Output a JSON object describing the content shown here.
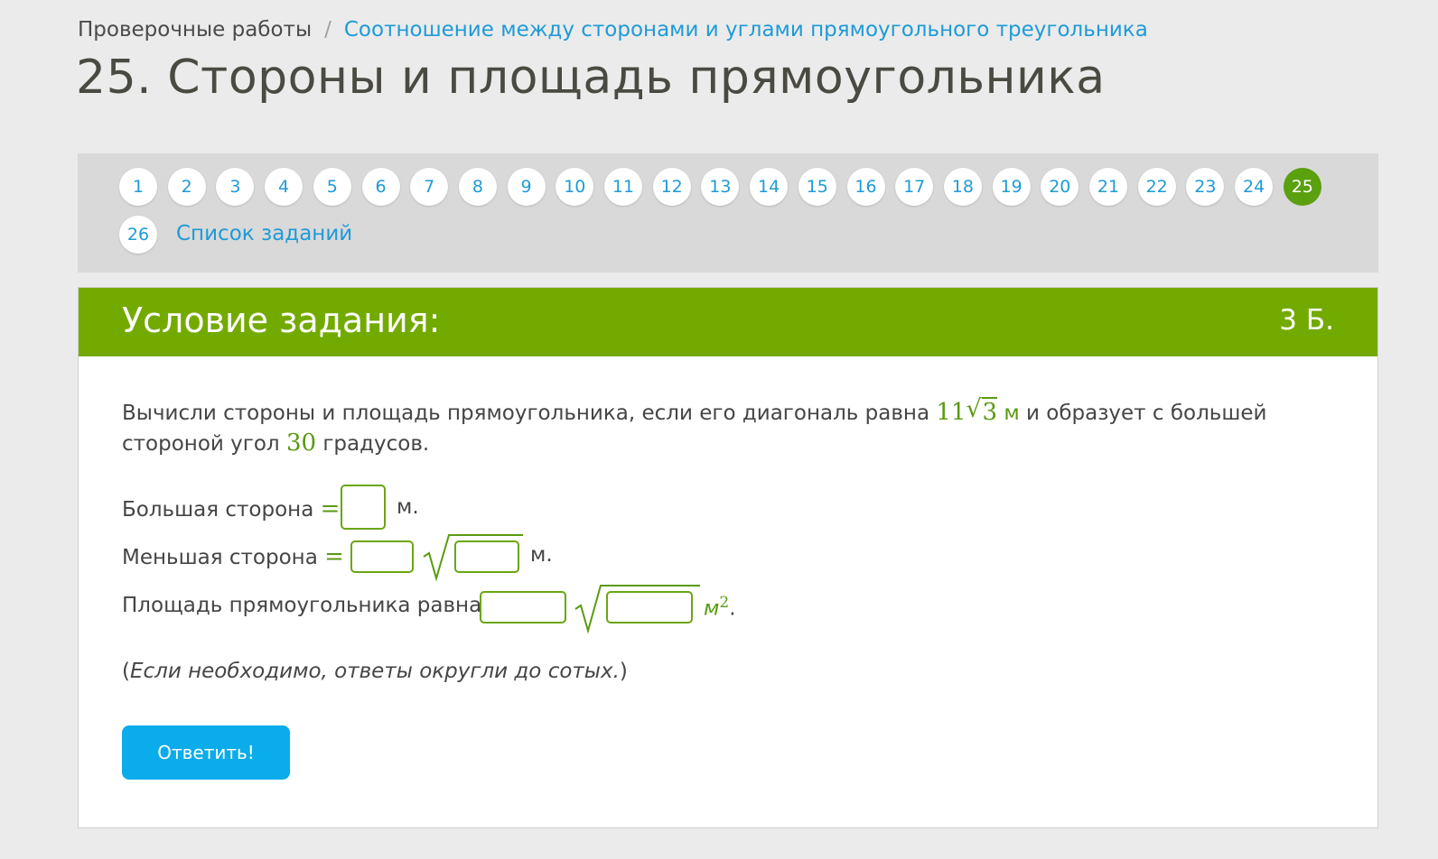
{
  "breadcrumb": {
    "root": "Проверочные работы",
    "separator": "/",
    "current": "Соотношение между сторонами и углами прямоугольного треугольника"
  },
  "page_title": "25. Стороны и площадь прямоугольника",
  "nav": {
    "items": [
      "1",
      "2",
      "3",
      "4",
      "5",
      "6",
      "7",
      "8",
      "9",
      "10",
      "11",
      "12",
      "13",
      "14",
      "15",
      "16",
      "17",
      "18",
      "19",
      "20",
      "21",
      "22",
      "23",
      "24",
      "25",
      "26"
    ],
    "active": "25",
    "task_list_label": "Список заданий"
  },
  "task": {
    "header_title": "Условие задания:",
    "points": "3 Б.",
    "text_part1": "Вычисли стороны и площадь прямоугольника, если его диагональ равна",
    "diag_coef": "11",
    "diag_root": "3",
    "diag_unit": "м",
    "text_part2": "и образует с большей стороной угол",
    "angle": "30",
    "text_part3": "градусов.",
    "rows": {
      "bigger_label": "Большая сторона",
      "smaller_label": "Меньшая сторона",
      "area_label": "Площадь прямоугольника равна",
      "equals": "=",
      "unit_m": "м.",
      "unit_area": "м",
      "area_exp": "2",
      "period": "."
    },
    "hint_open": "(",
    "hint_text": "Если необходимо, ответы округли до сотых.",
    "hint_close": ")",
    "submit_label": "Ответить!"
  },
  "colors": {
    "accent_green": "#73aa00",
    "active_circle": "#5ba00f",
    "link_blue": "#1e9bd7",
    "button_blue": "#0aacea"
  }
}
